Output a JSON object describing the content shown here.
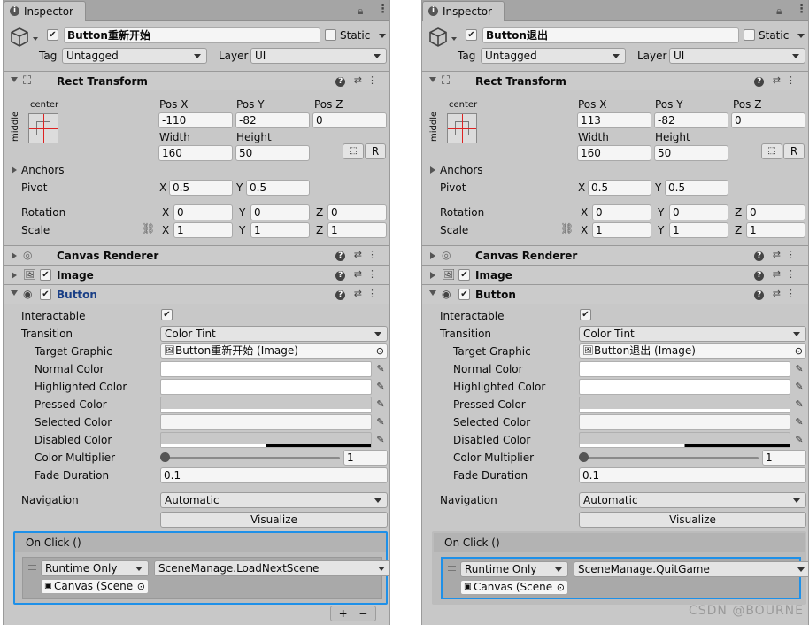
{
  "tab_title": "Inspector",
  "common": {
    "static_label": "Static",
    "tag_label": "Tag",
    "tag_value": "Untagged",
    "layer_label": "Layer",
    "layer_value": "UI",
    "rect_transform": "Rect Transform",
    "anchor_h": "center",
    "anchor_v": "middle",
    "posx": "Pos X",
    "posy": "Pos Y",
    "posz": "Pos Z",
    "width": "Width",
    "height": "Height",
    "anchors": "Anchors",
    "pivot": "Pivot",
    "rotation": "Rotation",
    "scale": "Scale",
    "x": "X",
    "y": "Y",
    "z": "Z",
    "r_btn": "R",
    "canvas_renderer": "Canvas Renderer",
    "image": "Image",
    "button": "Button",
    "interactable": "Interactable",
    "transition": "Transition",
    "transition_value": "Color Tint",
    "target_graphic": "Target Graphic",
    "normal_color": "Normal Color",
    "highlighted_color": "Highlighted Color",
    "pressed_color": "Pressed Color",
    "selected_color": "Selected Color",
    "disabled_color": "Disabled Color",
    "color_multiplier": "Color Multiplier",
    "color_multiplier_value": "1",
    "fade_duration": "Fade Duration",
    "fade_duration_value": "0.1",
    "navigation": "Navigation",
    "navigation_value": "Automatic",
    "visualize": "Visualize",
    "on_click": "On Click ()",
    "runtime": "Runtime Only",
    "canvas_obj": "Canvas (Scene",
    "add": "+",
    "remove": "−"
  },
  "left": {
    "name": "Button重新开始",
    "posx": "-110",
    "posy": "-82",
    "posz": "0",
    "width": "160",
    "height": "50",
    "pivot_x": "0.5",
    "pivot_y": "0.5",
    "rot_x": "0",
    "rot_y": "0",
    "rot_z": "0",
    "scale_x": "1",
    "scale_y": "1",
    "scale_z": "1",
    "target_graphic_value": "Button重新开始 (Image)",
    "function": "SceneManage.LoadNextScene"
  },
  "right": {
    "name": "Button退出",
    "posx": "113",
    "posy": "-82",
    "posz": "0",
    "width": "160",
    "height": "50",
    "pivot_x": "0.5",
    "pivot_y": "0.5",
    "rot_x": "0",
    "rot_y": "0",
    "rot_z": "0",
    "scale_x": "1",
    "scale_y": "1",
    "scale_z": "1",
    "target_graphic_value": "Button退出 (Image)",
    "function": "SceneManage.QuitGame"
  },
  "watermark": "CSDN @BOURNE",
  "colors": {
    "highlight_border": "#1e90e8",
    "panel_bg": "#c8c8c8"
  }
}
